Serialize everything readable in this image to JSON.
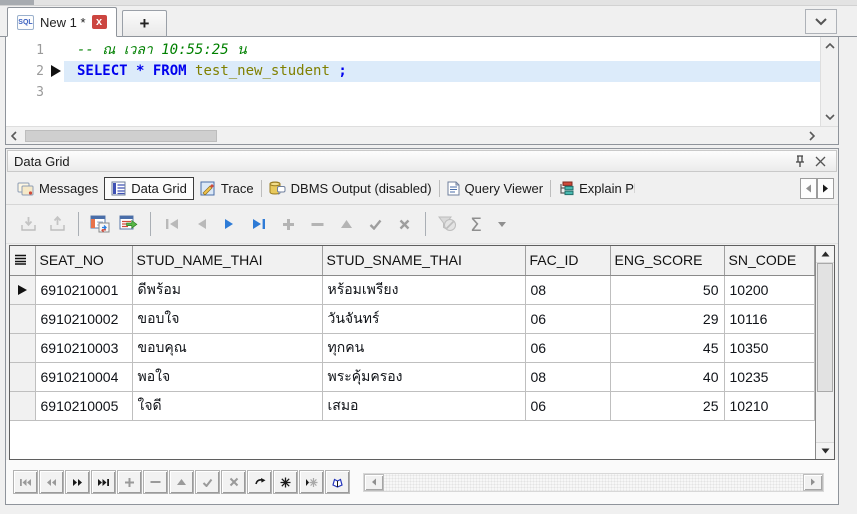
{
  "tabbar": {
    "active_tab": "New 1 *",
    "sql_icon_text": "SQL",
    "close_icon_text": "x",
    "new_tab_label": "+",
    "dropdown_icon": "chevron-down-icon"
  },
  "editor": {
    "line_numbers": {
      "l1": "1",
      "l2": "2",
      "l3": "3"
    },
    "comment_line": "-- ณ เวลา 10:55:25 น",
    "sql_line": {
      "kw_select": "SELECT ",
      "star": "* ",
      "kw_from": "FROM ",
      "identifier": "test_new_student ",
      "semicolon": ";"
    },
    "colors": {
      "comment": "#008000",
      "keyword": "#0000ee",
      "identifier": "#808000",
      "active_line_bg": "#dcebfa"
    },
    "current_line": "2"
  },
  "panel": {
    "title": "Data Grid",
    "title_icons": [
      "pin-icon",
      "close-icon"
    ],
    "tabs": {
      "messages": "Messages",
      "data_grid": "Data Grid",
      "trace": "Trace",
      "dbms_output": "DBMS Output (disabled)",
      "query_viewer": "Query Viewer",
      "explain_plan": "Explain Pl"
    },
    "selected_tab": "Data Grid",
    "tab_icons": [
      "messages-icon",
      "data-grid-icon",
      "trace-icon",
      "dbms-output-icon",
      "query-viewer-icon",
      "explain-plan-icon"
    ],
    "tab_scroll_icons": [
      "scroll-left-icon",
      "scroll-right-icon"
    ]
  },
  "toolbar": {
    "sigma_label": "Σ",
    "buttons": [
      {
        "name": "import-data",
        "enabled": false
      },
      {
        "name": "export-data",
        "enabled": false
      },
      {
        "name": "fetch-to-grid",
        "enabled": true
      },
      {
        "name": "export-dataset",
        "enabled": true
      },
      {
        "name": "first-record",
        "enabled": false
      },
      {
        "name": "prior-record",
        "enabled": false
      },
      {
        "name": "next-record",
        "enabled": true
      },
      {
        "name": "last-record",
        "enabled": true
      },
      {
        "name": "insert-record",
        "enabled": false
      },
      {
        "name": "delete-record",
        "enabled": false
      },
      {
        "name": "edit-record",
        "enabled": false
      },
      {
        "name": "post-edit",
        "enabled": false
      },
      {
        "name": "cancel-edit",
        "enabled": false
      },
      {
        "name": "filter-data",
        "enabled": false
      },
      {
        "name": "aggregate-sum",
        "enabled": true
      }
    ]
  },
  "grid": {
    "columns": {
      "c1": "SEAT_NO",
      "c2": "STUD_NAME_THAI",
      "c3": "STUD_SNAME_THAI",
      "c4": "FAC_ID",
      "c5": "ENG_SCORE",
      "c6": "SN_CODE"
    },
    "rows": [
      {
        "seat_no": "6910210001",
        "name": "ดีพร้อม",
        "sname": "หร้อมเพรียง",
        "fac_id": "08",
        "eng_score": "50",
        "sn_code": "10200",
        "current": true
      },
      {
        "seat_no": "6910210002",
        "name": "ขอบใจ",
        "sname": "วันจันทร์",
        "fac_id": "06",
        "eng_score": "29",
        "sn_code": "10116",
        "current": false
      },
      {
        "seat_no": "6910210003",
        "name": "ขอบคุณ",
        "sname": "ทุกคน",
        "fac_id": "06",
        "eng_score": "45",
        "sn_code": "10350",
        "current": false
      },
      {
        "seat_no": "6910210004",
        "name": "พอใจ",
        "sname": "พระคุ้มครอง",
        "fac_id": "08",
        "eng_score": "40",
        "sn_code": "10235",
        "current": false
      },
      {
        "seat_no": "6910210005",
        "name": "ใจดี",
        "sname": "เสมอ",
        "fac_id": "06",
        "eng_score": "25",
        "sn_code": "10210",
        "current": false
      }
    ]
  },
  "navigator": {
    "buttons": [
      {
        "name": "nav-first",
        "enabled": false
      },
      {
        "name": "nav-prior",
        "enabled": false
      },
      {
        "name": "nav-next",
        "enabled": true
      },
      {
        "name": "nav-last",
        "enabled": true
      },
      {
        "name": "nav-insert",
        "enabled": false
      },
      {
        "name": "nav-delete",
        "enabled": false
      },
      {
        "name": "nav-edit",
        "enabled": false
      },
      {
        "name": "nav-post",
        "enabled": false
      },
      {
        "name": "nav-cancel",
        "enabled": false
      },
      {
        "name": "nav-refresh",
        "enabled": true
      },
      {
        "name": "nav-bookmark-set",
        "enabled": true
      },
      {
        "name": "nav-bookmark-goto",
        "enabled": false
      },
      {
        "name": "nav-edit-mode",
        "enabled": true
      }
    ]
  }
}
